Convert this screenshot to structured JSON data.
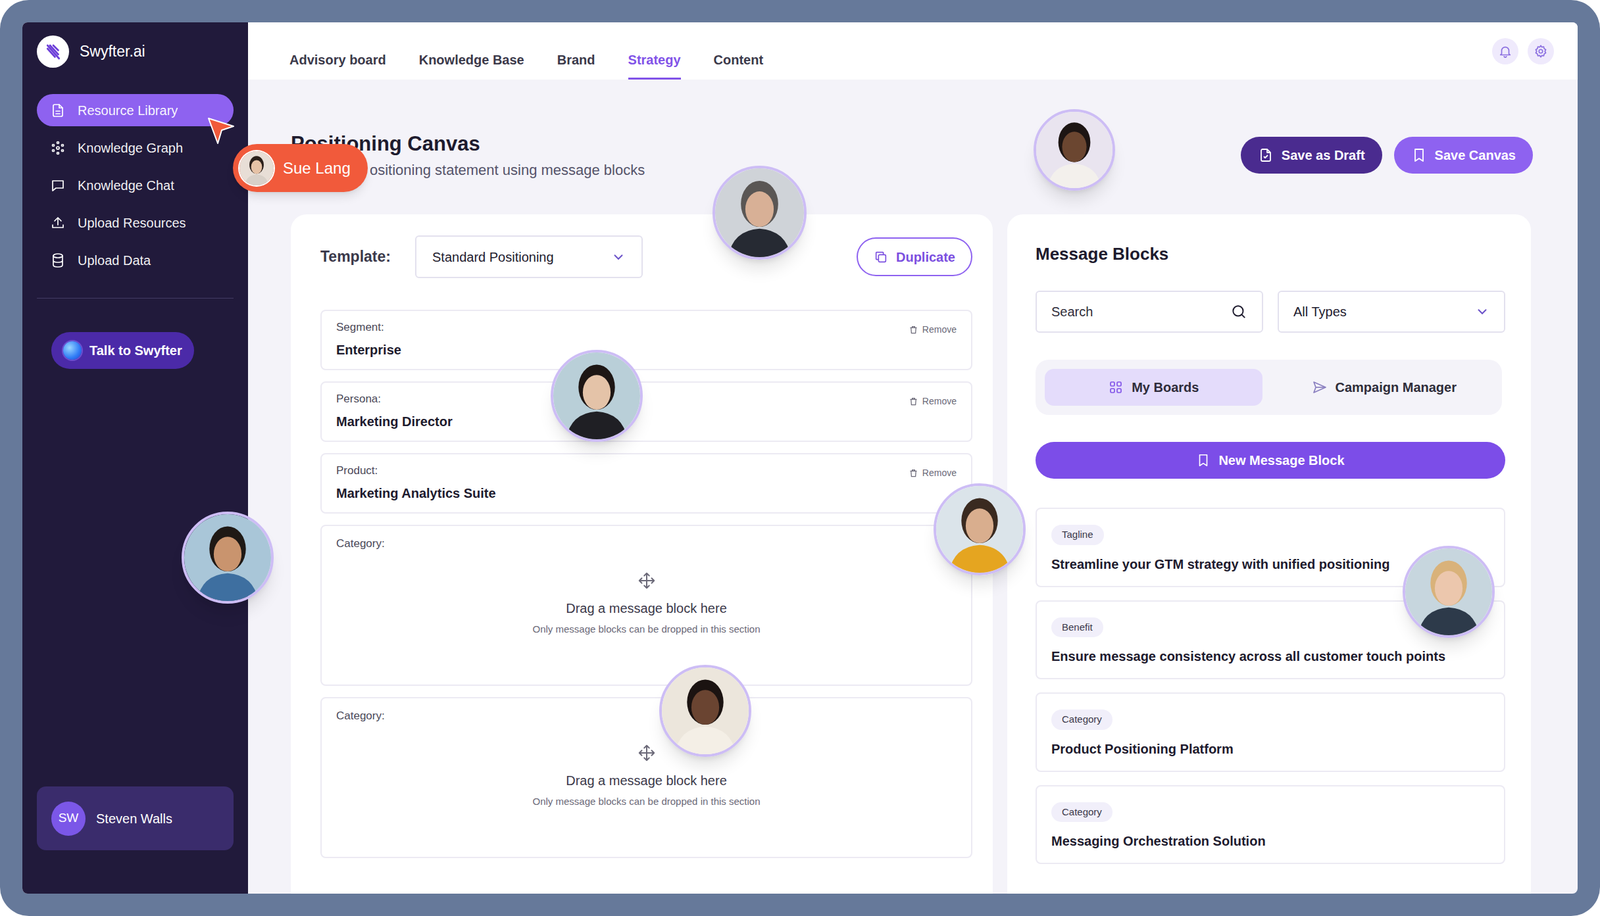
{
  "app": {
    "name": "Swyfter.ai"
  },
  "sidebar": {
    "items": [
      {
        "label": "Resource Library",
        "selected": true
      },
      {
        "label": "Knowledge Graph",
        "selected": false
      },
      {
        "label": "Knowledge Chat",
        "selected": false
      },
      {
        "label": "Upload Resources",
        "selected": false
      },
      {
        "label": "Upload Data",
        "selected": false
      }
    ],
    "assistant_button": "Talk to Swyfter",
    "user": {
      "initials": "SW",
      "name": "Steven Walls"
    }
  },
  "tabs": [
    {
      "label": "Advisory board",
      "selected": false
    },
    {
      "label": "Knowledge Base",
      "selected": false
    },
    {
      "label": "Brand",
      "selected": false
    },
    {
      "label": "Strategy",
      "selected": true
    },
    {
      "label": "Content",
      "selected": false
    }
  ],
  "presence": {
    "cursor_label": "Sue Lang"
  },
  "page": {
    "title": "Positioning Canvas",
    "subtitle": "ositioning statement using message blocks"
  },
  "actions": {
    "draft": "Save as Draft",
    "save": "Save Canvas"
  },
  "canvas": {
    "template_label": "Template:",
    "template": "Standard Positioning",
    "duplicate": "Duplicate",
    "fields": [
      {
        "kind": "filled",
        "label": "Segment:",
        "value": "Enterprise",
        "remove": "Remove"
      },
      {
        "kind": "filled",
        "label": "Persona:",
        "value": "Marketing Director",
        "remove": "Remove"
      },
      {
        "kind": "filled",
        "label": "Product:",
        "value": "Marketing Analytics Suite",
        "remove": "Remove"
      },
      {
        "kind": "drop",
        "label": "Category:",
        "hint": "Drag a message block here",
        "note": "Only message blocks can be dropped in this section"
      },
      {
        "kind": "drop",
        "label": "Category:",
        "hint": "Drag a message block here",
        "note": "Only message blocks can be dropped in this section"
      }
    ]
  },
  "message_blocks": {
    "title": "Message Blocks",
    "search": {
      "placeholder": "Search"
    },
    "type_filter": "All Types",
    "views": [
      {
        "label": "My Boards",
        "selected": true
      },
      {
        "label": "Campaign Manager",
        "selected": false
      }
    ],
    "new_button": "New Message Block",
    "items": [
      {
        "tag": "Tagline",
        "text": "Streamline your GTM strategy with unified positioning"
      },
      {
        "tag": "Benefit",
        "text": "Ensure message consistency across all customer touch points"
      },
      {
        "tag": "Category",
        "text": "Product Positioning Platform"
      },
      {
        "tag": "Category",
        "text": "Messaging Orchestration Solution"
      }
    ]
  }
}
